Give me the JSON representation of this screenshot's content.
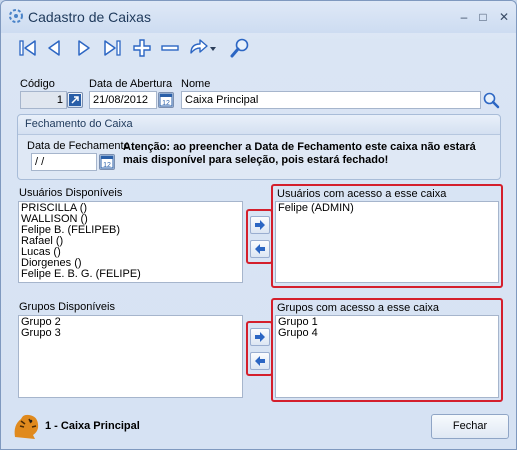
{
  "window": {
    "title": "Cadastro de Caixas",
    "minimize": "–",
    "maximize": "□",
    "close": "✕"
  },
  "toolbar": {
    "buttons": [
      "first-icon",
      "previous-icon",
      "next-icon",
      "last-icon",
      "add-icon",
      "remove-icon",
      "refresh-icon",
      "search-icon"
    ]
  },
  "form": {
    "codigo_label": "Código",
    "codigo_value": "1",
    "data_abertura_label": "Data de Abertura",
    "data_abertura_value": "21/08/2012",
    "nome_label": "Nome",
    "nome_value": "Caixa Principal",
    "calendar_day": "12"
  },
  "fechamento": {
    "title": "Fechamento do Caixa",
    "data_label": "Data de Fechamento",
    "data_value": " / /",
    "warning": "Atenção: ao preencher a Data de Fechamento este caixa não estará mais disponível para seleção, pois estará fechado!"
  },
  "usuarios": {
    "disponiveis_label": "Usuários Disponíveis",
    "disponiveis": [
      "PRISCILLA ()",
      "WALLISON ()",
      "Felipe B. (FELIPEB)",
      "Rafael ()",
      "Lucas ()",
      "Diorgenes ()",
      "Felipe E. B. G. (FELIPE)"
    ],
    "acesso_label": "Usuários com acesso a esse caixa",
    "acesso": [
      "Felipe (ADMIN)"
    ]
  },
  "grupos": {
    "disponiveis_label": "Grupos Disponíveis",
    "disponiveis": [
      "Grupo 2",
      "Grupo 3"
    ],
    "acesso_label": "Grupos com acesso a esse caixa",
    "acesso": [
      "Grupo 1",
      "Grupo 4"
    ]
  },
  "status": {
    "text": "1 - Caixa Principal"
  },
  "buttons": {
    "fechar": "Fechar"
  },
  "colors": {
    "highlight_frame": "#d41f2c",
    "arrow_blue": "#2c66c3"
  }
}
